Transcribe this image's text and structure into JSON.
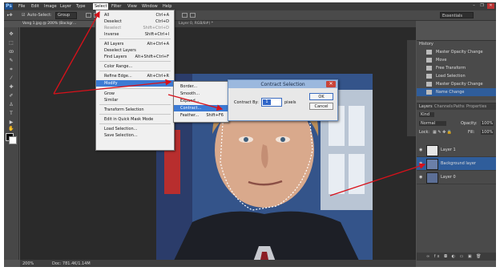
{
  "app": {
    "logo": "Ps"
  },
  "menubar": {
    "items": [
      "File",
      "Edit",
      "Image",
      "Layer",
      "Type",
      "Select",
      "Filter",
      "View",
      "Window",
      "Help"
    ],
    "active": "Select",
    "window_controls": [
      "–",
      "❐",
      "✕"
    ]
  },
  "options_bar": {
    "auto_select": "Auto-Select:",
    "group_dropdown": "Group",
    "workspace": "Essentials"
  },
  "document": {
    "tab_title": "Vong 1.jpg @ 200% (Backgr…",
    "tab_title_2": "Layer 0, RGB/8#) *"
  },
  "select_menu": {
    "items": [
      {
        "label": "All",
        "shortcut": "Ctrl+A",
        "disabled": false
      },
      {
        "label": "Deselect",
        "shortcut": "Ctrl+D",
        "disabled": false
      },
      {
        "label": "Reselect",
        "shortcut": "Shift+Ctrl+D",
        "disabled": true
      },
      {
        "label": "Inverse",
        "shortcut": "Shift+Ctrl+I",
        "disabled": false
      },
      {
        "label": "All Layers",
        "shortcut": "Alt+Ctrl+A",
        "disabled": false
      },
      {
        "label": "Deselect Layers",
        "shortcut": "",
        "disabled": false
      },
      {
        "label": "Find Layers",
        "shortcut": "Alt+Shift+Ctrl+F",
        "disabled": false
      },
      {
        "label": "Color Range...",
        "shortcut": "",
        "disabled": false
      },
      {
        "label": "Refine Edge...",
        "shortcut": "Alt+Ctrl+R",
        "disabled": false
      },
      {
        "label": "Modify",
        "shortcut": "▸",
        "disabled": false
      },
      {
        "label": "Grow",
        "shortcut": "",
        "disabled": false
      },
      {
        "label": "Similar",
        "shortcut": "",
        "disabled": false
      },
      {
        "label": "Transform Selection",
        "shortcut": "",
        "disabled": false
      },
      {
        "label": "Edit in Quick Mask Mode",
        "shortcut": "",
        "disabled": false
      },
      {
        "label": "Load Selection...",
        "shortcut": "",
        "disabled": false
      },
      {
        "label": "Save Selection...",
        "shortcut": "",
        "disabled": false
      }
    ]
  },
  "modify_menu": {
    "items": [
      {
        "label": "Border...",
        "shortcut": ""
      },
      {
        "label": "Smooth...",
        "shortcut": ""
      },
      {
        "label": "Expand...",
        "shortcut": ""
      },
      {
        "label": "Contract...",
        "shortcut": ""
      },
      {
        "label": "Feather...",
        "shortcut": "Shift+F6"
      }
    ]
  },
  "dialog": {
    "title": "Contract Selection",
    "label": "Contract By:",
    "value": "1",
    "unit": "pixels",
    "ok": "OK",
    "cancel": "Cancel",
    "close": "✕"
  },
  "history": {
    "tab": "History",
    "items": [
      "Master Opacity Change",
      "Move",
      "Free Transform",
      "Load Selection",
      "Master Opacity Change",
      "Name Change"
    ]
  },
  "layers": {
    "tabs": [
      "Layers",
      "Channels",
      "Paths",
      "Properties"
    ],
    "kind": "Kind",
    "blend_mode": "Normal",
    "opacity_label": "Opacity:",
    "opacity_value": "100%",
    "lock_label": "Lock:",
    "fill_label": "Fill:",
    "fill_value": "100%",
    "items": [
      {
        "name": "Layer 1",
        "selected": false
      },
      {
        "name": "Background layer",
        "selected": true
      },
      {
        "name": "Layer 0",
        "selected": false
      }
    ],
    "bottom_icons": "∞  fx  ◘  ◐  ▭  ▣  🗑"
  },
  "status": {
    "zoom": "200%",
    "doc": "Doc: 781.4K/1.14M"
  },
  "colors": {
    "annotation_arrow": "#d8111a",
    "highlight": "#3d7bd4",
    "panel_bg": "#4a4a4a"
  }
}
